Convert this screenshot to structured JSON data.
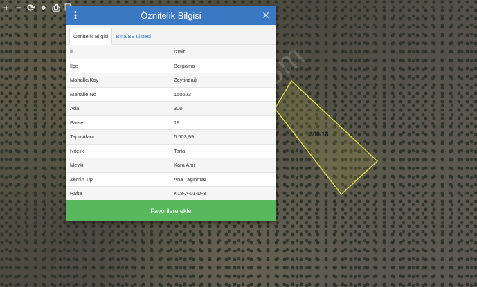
{
  "map": {
    "toolbar": [
      {
        "name": "zoom-in",
        "glyph": "+"
      },
      {
        "name": "zoom-out",
        "glyph": "−"
      },
      {
        "name": "refresh",
        "glyph": "⟳"
      },
      {
        "name": "locate",
        "glyph": "⌖"
      },
      {
        "name": "print",
        "glyph": "⎙"
      },
      {
        "name": "measure",
        "glyph": "⎘"
      }
    ],
    "parcel_label": "300/18",
    "watermark": "emlakjet.com"
  },
  "panel": {
    "title": "Öznitelik Bilgisi",
    "close_glyph": "✕",
    "tabs": [
      "Öznitelik Bilgisi",
      "Bina/BB Listesi"
    ],
    "rows": [
      {
        "key": "İl",
        "value": "İzmir"
      },
      {
        "key": "İlçe",
        "value": "Bergama"
      },
      {
        "key": "Mahalle/Koy",
        "value": "Zeytindağ"
      },
      {
        "key": "Mahalle No",
        "value": "150623"
      },
      {
        "key": "Ada",
        "value": "300"
      },
      {
        "key": "Parsel",
        "value": "18"
      },
      {
        "key": "Tapu Alanı",
        "value": "6.503,99"
      },
      {
        "key": "Nitelik",
        "value": "Tarla"
      },
      {
        "key": "Mevkii",
        "value": "Kara Ahır"
      },
      {
        "key": "Zemin Tip",
        "value": "Ana Taşınmaz"
      },
      {
        "key": "Pafta",
        "value": "K18-A-01-D-3"
      }
    ],
    "favorite_button": "Favorilere ekle"
  },
  "colors": {
    "header": "#3b78c4",
    "button": "#59b85d",
    "parcel_outline": "#d8d84a"
  }
}
